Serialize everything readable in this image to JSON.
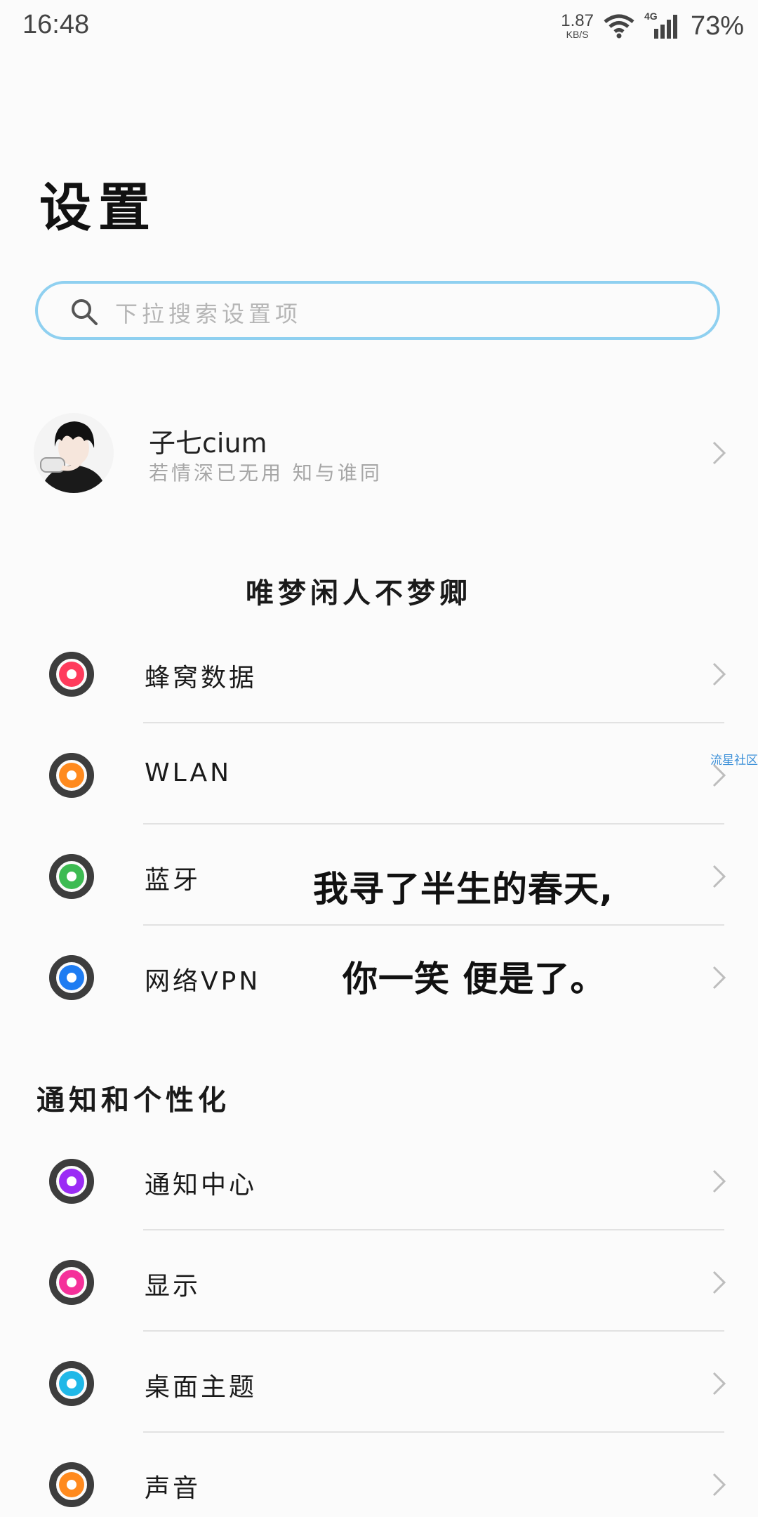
{
  "status_bar": {
    "time": "16:48",
    "net_speed_value": "1.87",
    "net_speed_unit": "KB/S",
    "network_type": "4G",
    "battery": "73%"
  },
  "page_title": "设置",
  "search": {
    "placeholder": "下拉搜索设置项"
  },
  "profile": {
    "name": "子七cium",
    "signature": "若情深已无用 知与谁同"
  },
  "section_1_title": "唯梦闲人不梦卿",
  "section_1_items": [
    {
      "label": "蜂窝数据",
      "color": "#ff3b5c"
    },
    {
      "label": "WLAN",
      "color": "#ff8a1e"
    },
    {
      "label": "蓝牙",
      "color": "#3dbb52"
    },
    {
      "label": "网络VPN",
      "color": "#1e7cf2"
    }
  ],
  "overlay": {
    "line1": "我寻了半生的春天,",
    "line2": "你一笑 便是了。"
  },
  "watermark": "流星社区",
  "section_2_title": "通知和个性化",
  "section_2_items": [
    {
      "label": "通知中心",
      "color": "#9b2cf5"
    },
    {
      "label": "显示",
      "color": "#f5309a"
    },
    {
      "label": "桌面主题",
      "color": "#1fb8e8"
    },
    {
      "label": "声音",
      "color": "#ff8a1e"
    }
  ]
}
